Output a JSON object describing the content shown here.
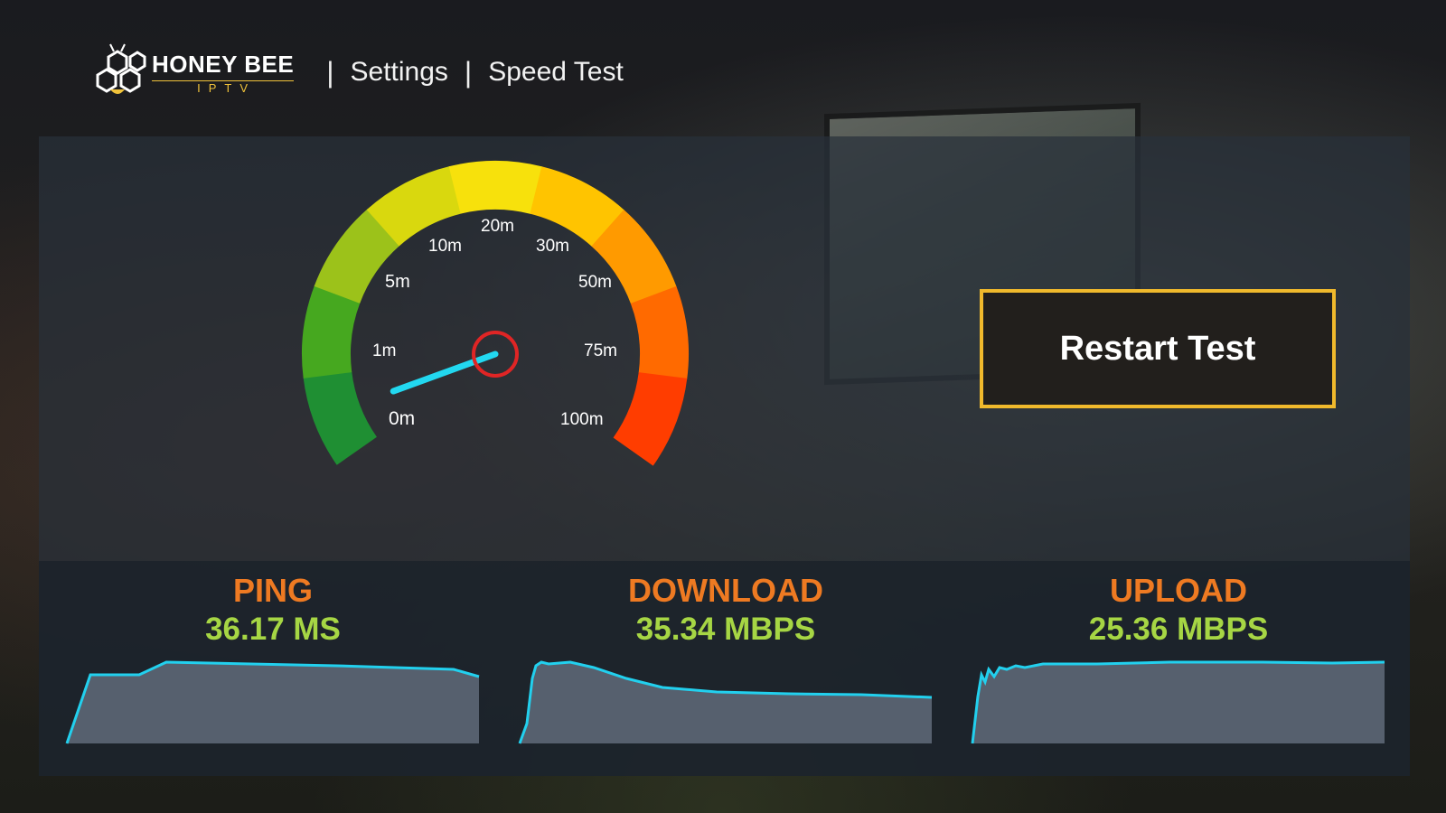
{
  "brand": {
    "name": "HONEY BEE",
    "sub": "IPTV",
    "icon": "honeycomb-bee-icon",
    "accent": "#f0c23a"
  },
  "breadcrumb": {
    "items": [
      "Settings",
      "Speed Test"
    ]
  },
  "gauge": {
    "ticks": [
      "0m",
      "1m",
      "5m",
      "10m",
      "20m",
      "30m",
      "50m",
      "75m",
      "100m"
    ],
    "needle_level": 0.06,
    "needle_color": "#22d8f0",
    "hub_color": "#e02525"
  },
  "restart_button": {
    "label": "Restart Test"
  },
  "stats": {
    "ping": {
      "label": "PING",
      "value": "36.17 MS"
    },
    "download": {
      "label": "DOWNLOAD",
      "value": "35.34 MBPS"
    },
    "upload": {
      "label": "UPLOAD",
      "value": "25.36 MBPS"
    }
  },
  "colors": {
    "label": "#ee7a22",
    "value": "#a6d644",
    "graph_line": "#22d0ee",
    "graph_fill": "#5d6775",
    "button_border": "#f0b92c"
  }
}
